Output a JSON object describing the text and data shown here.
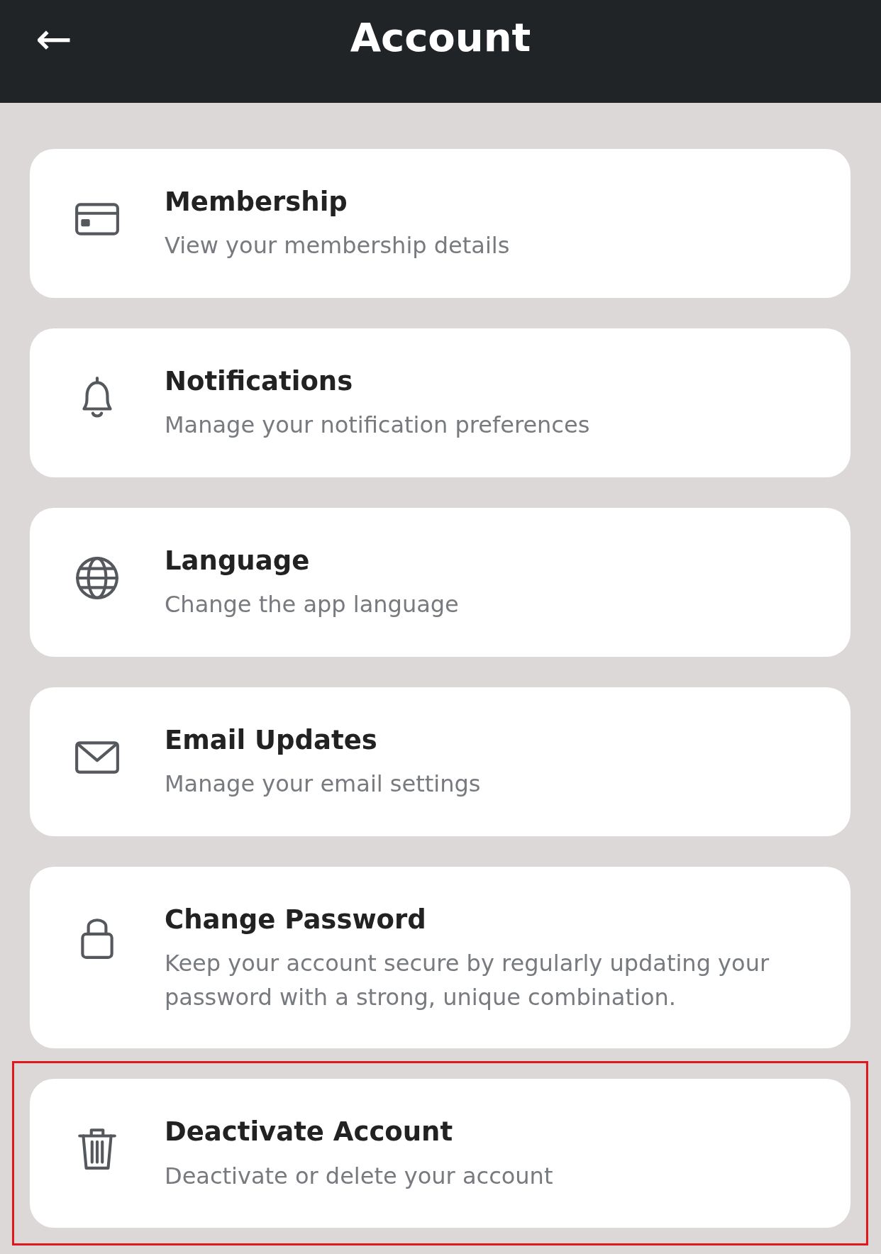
{
  "header": {
    "back": "←",
    "title": "Account"
  },
  "items": [
    {
      "title": "Membership",
      "subtitle": "View your membership details",
      "highlighted": false
    },
    {
      "title": "Notifications",
      "subtitle": "Manage your notification preferences",
      "highlighted": false
    },
    {
      "title": "Language",
      "subtitle": "Change the app language",
      "highlighted": false
    },
    {
      "title": "Email Updates",
      "subtitle": "Manage your email settings",
      "highlighted": false
    },
    {
      "title": "Change Password",
      "subtitle": "Keep your account secure by regularly updating your password with a strong, unique combination.",
      "highlighted": false
    },
    {
      "title": "Deactivate Account",
      "subtitle": "Deactivate or delete your account",
      "highlighted": true
    }
  ]
}
